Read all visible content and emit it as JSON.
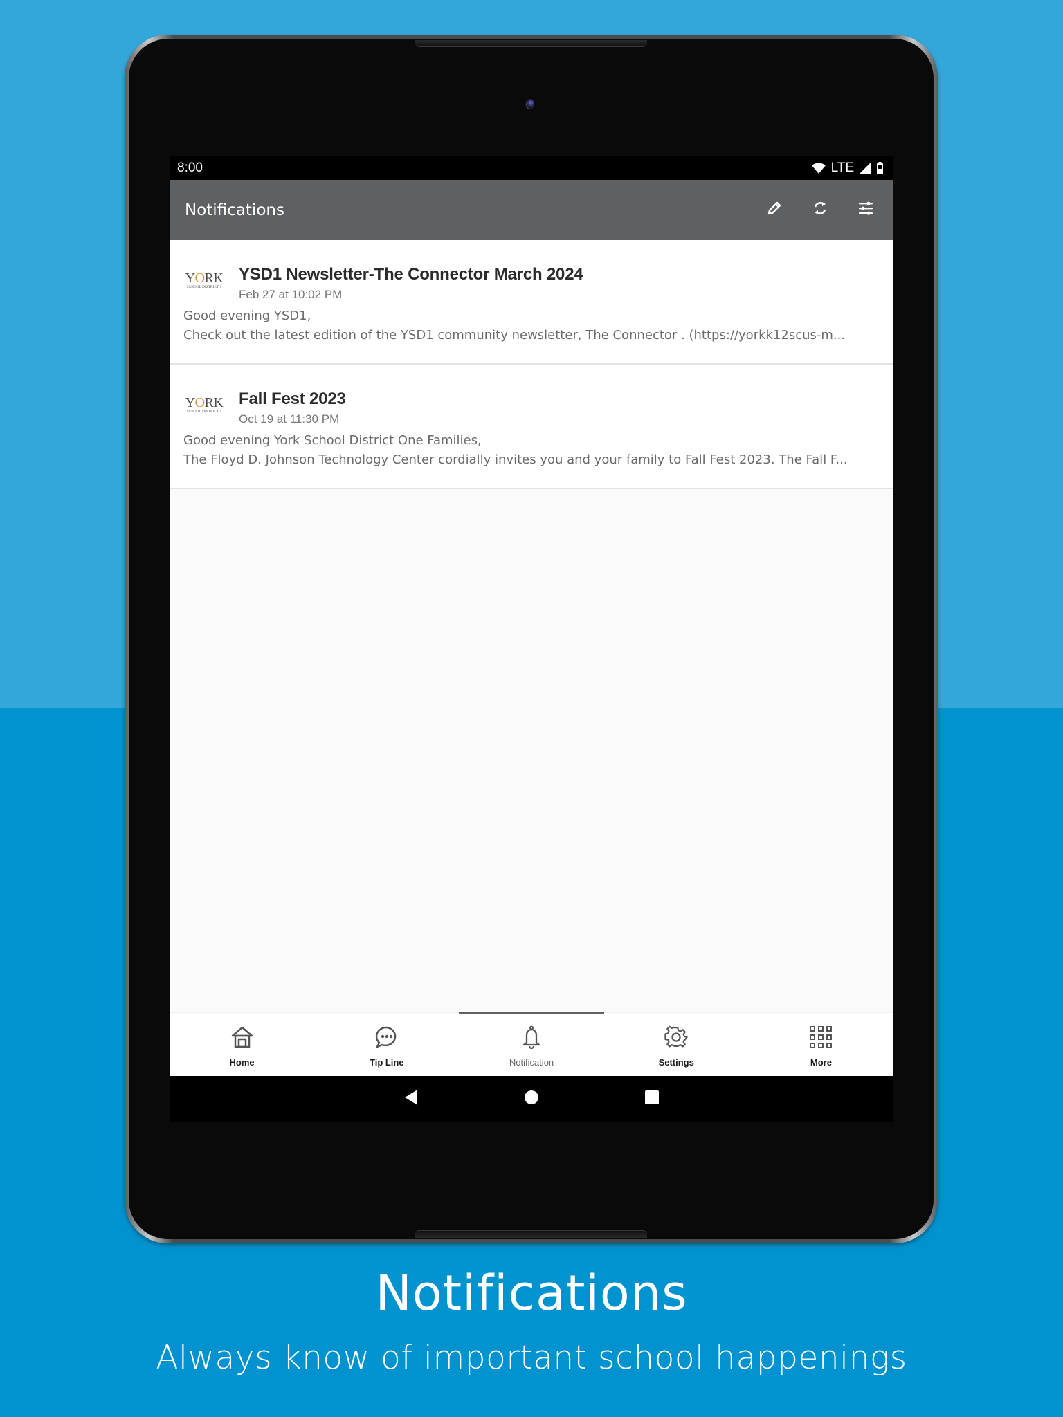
{
  "background": {
    "top_color": "#34a7da",
    "bottom_color": "#0093cf"
  },
  "status_bar": {
    "time": "8:00",
    "network": "LTE",
    "icons": [
      "wifi-icon",
      "cell-signal-icon",
      "battery-icon"
    ]
  },
  "app_bar": {
    "title": "Notifications",
    "color": "#5f6062",
    "actions": [
      {
        "name": "edit",
        "icon": "pencil-icon"
      },
      {
        "name": "refresh",
        "icon": "refresh-icon"
      },
      {
        "name": "filter",
        "icon": "sliders-icon"
      }
    ]
  },
  "notifications": [
    {
      "logo": {
        "word_pre": "Y",
        "word_o": "O",
        "word_post": "RK",
        "sub": "SCHOOL DISTRICT 1"
      },
      "title": "YSD1 Newsletter-The Connector March 2024",
      "date": "Feb 27 at 10:02 PM",
      "body_line1": "Good evening YSD1,",
      "body_line2": "Check out the latest edition of the YSD1 community newsletter, The Connector . (https://yorkk12scus-m..."
    },
    {
      "logo": {
        "word_pre": "Y",
        "word_o": "O",
        "word_post": "RK",
        "sub": "SCHOOL DISTRICT 1"
      },
      "title": "Fall Fest 2023",
      "date": "Oct 19 at 11:30 PM",
      "body_line1": "Good evening York School District One Families,",
      "body_line2": "The Floyd D. Johnson Technology Center cordially invites you and your family to Fall Fest 2023. The Fall F..."
    }
  ],
  "bottom_nav": {
    "active_index": 2,
    "items": [
      {
        "label": "Home",
        "icon": "home-icon"
      },
      {
        "label": "Tip Line",
        "icon": "chat-bubble-icon"
      },
      {
        "label": "Notification",
        "icon": "bell-icon"
      },
      {
        "label": "Settings",
        "icon": "gear-icon"
      },
      {
        "label": "More",
        "icon": "grid-icon"
      }
    ]
  },
  "system_nav": [
    "back",
    "home",
    "recents"
  ],
  "caption": {
    "title": "Notifications",
    "subtitle": "Always know of important school happenings"
  }
}
